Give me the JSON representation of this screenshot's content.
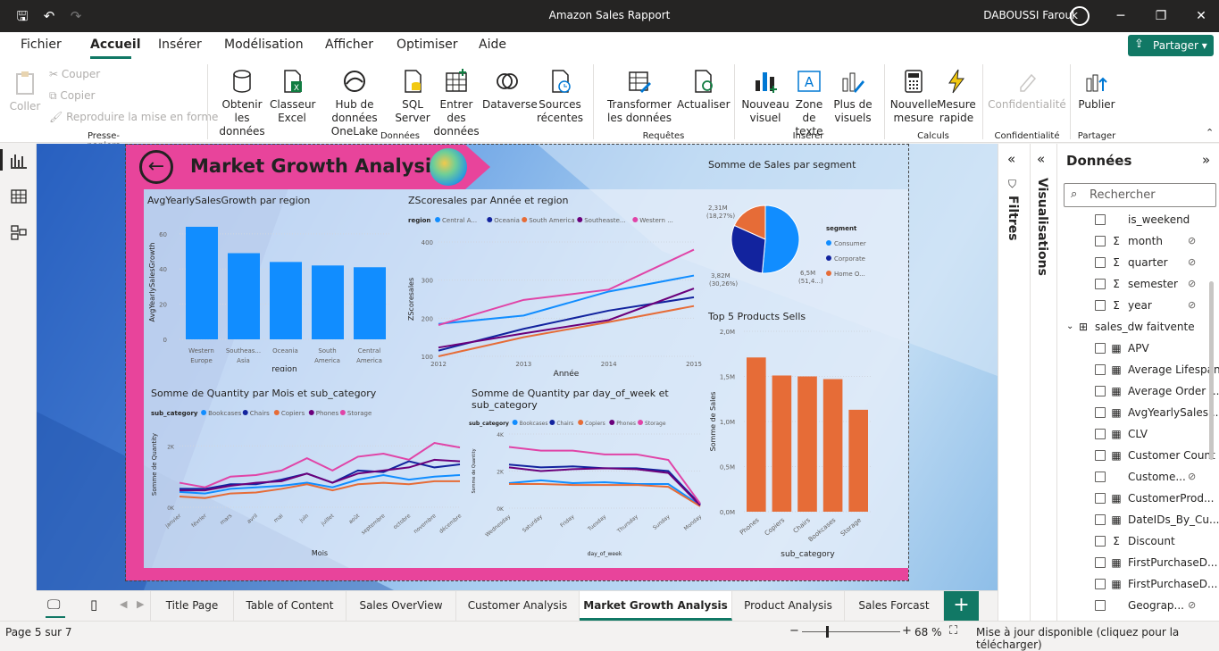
{
  "titlebar": {
    "title": "Amazon Sales Rapport",
    "user": "DABOUSSI Farouk"
  },
  "menu": {
    "items": [
      "Fichier",
      "Accueil",
      "Insérer",
      "Modélisation",
      "Afficher",
      "Optimiser",
      "Aide"
    ],
    "share": "Partager"
  },
  "ribbon": {
    "clipboard": {
      "paste": "Coller",
      "cut": "Couper",
      "copy": "Copier",
      "format": "Reproduire la mise en forme",
      "group": "Presse-papiers"
    },
    "data": {
      "get": "Obtenir les données",
      "excel": "Classeur Excel",
      "onelake": "Hub de données OneLake",
      "sql": "SQL Server",
      "enter": "Entrer des données",
      "dataverse": "Dataverse",
      "recent": "Sources récentes",
      "group": "Données"
    },
    "queries": {
      "transform": "Transformer les données",
      "refresh": "Actualiser",
      "group": "Requêtes"
    },
    "insert": {
      "visual": "Nouveau visuel",
      "textbox": "Zone de texte",
      "more": "Plus de visuels",
      "group": "Insérer"
    },
    "calc": {
      "measure": "Nouvelle mesure",
      "quick": "Mesure rapide",
      "group": "Calculs"
    },
    "sens": {
      "label": "Confidentialité",
      "group": "Confidentialité"
    },
    "share": {
      "publish": "Publier",
      "group": "Partager"
    }
  },
  "report": {
    "title": "Market Growth Analysis",
    "chart1_title": "AvgYearlySalesGrowth par region",
    "chart2_title": "ZScoresales par Année et region",
    "chart3_title": "Somme de Sales par segment",
    "chart4_title": "Top 5 Products Sells",
    "chart5_title": "Somme de Quantity par Mois et sub_category",
    "chart6_title": "Somme de Quantity par day_of_week et sub_category"
  },
  "chart_data": [
    {
      "type": "bar",
      "title": "AvgYearlySalesGrowth par region",
      "xlabel": "region",
      "ylabel": "AvgYearlySalesGrowth",
      "categories": [
        "Western Europe",
        "Southeast Asia",
        "Oceania",
        "South America",
        "Central America"
      ],
      "values": [
        64,
        49,
        44,
        42,
        41
      ],
      "ylim": [
        0,
        65
      ],
      "yticks": [
        0,
        20,
        40,
        60
      ],
      "color": "#118dff"
    },
    {
      "type": "line",
      "title": "ZScoresales par Année et region",
      "xlabel": "Année",
      "ylabel": "ZScoresales",
      "legend_title": "region",
      "x": [
        2012,
        2013,
        2014,
        2015
      ],
      "ylim": [
        100,
        400
      ],
      "yticks": [
        100,
        200,
        300,
        400
      ],
      "series": [
        {
          "name": "Central A...",
          "color": "#118dff",
          "values": [
            185,
            207,
            270,
            312
          ]
        },
        {
          "name": "Oceania",
          "color": "#12239e",
          "values": [
            115,
            172,
            220,
            255
          ]
        },
        {
          "name": "South America",
          "color": "#e66c37",
          "values": [
            100,
            150,
            190,
            232
          ]
        },
        {
          "name": "Southeaste...",
          "color": "#6b007b",
          "values": [
            123,
            160,
            195,
            278
          ]
        },
        {
          "name": "Western ...",
          "color": "#e044a7",
          "values": [
            182,
            248,
            275,
            380
          ]
        }
      ]
    },
    {
      "type": "pie",
      "title": "Somme de Sales par segment",
      "legend_title": "segment",
      "series": [
        {
          "name": "Consumer",
          "color": "#118dff",
          "value": 6.5,
          "label": "6,5M (51,4...)"
        },
        {
          "name": "Corporate",
          "color": "#12239e",
          "value": 3.82,
          "label": "3,82M (30,26%)"
        },
        {
          "name": "Home O...",
          "color": "#e66c37",
          "value": 2.31,
          "label": "2,31M (18,27%)"
        }
      ]
    },
    {
      "type": "bar",
      "title": "Top 5 Products Sells",
      "xlabel": "sub_category",
      "ylabel": "Somme de Sales",
      "categories": [
        "Phones",
        "Copiers",
        "Chairs",
        "Bookcases",
        "Storage"
      ],
      "values": [
        1.71,
        1.51,
        1.5,
        1.47,
        1.13
      ],
      "ylim": [
        0,
        2
      ],
      "yticks": [
        "0,0M",
        "0,5M",
        "1,0M",
        "1,5M",
        "2,0M"
      ],
      "color": "#e66c37"
    },
    {
      "type": "line",
      "title": "Somme de Quantity par Mois et sub_category",
      "xlabel": "Mois",
      "ylabel": "Somme de Quantity",
      "legend_title": "sub_category",
      "x": [
        "janvier",
        "février",
        "mars",
        "avril",
        "mai",
        "juin",
        "juillet",
        "août",
        "septembre",
        "octobre",
        "novembre",
        "décembre"
      ],
      "ylim": [
        0,
        2800
      ],
      "yticks": [
        "0K",
        "2K"
      ],
      "series": [
        {
          "name": "Bookcases",
          "color": "#118dff",
          "values": [
            500,
            450,
            600,
            650,
            700,
            800,
            650,
            900,
            1050,
            900,
            1000,
            1050
          ]
        },
        {
          "name": "Chairs",
          "color": "#12239e",
          "values": [
            600,
            600,
            750,
            750,
            900,
            1100,
            800,
            1200,
            1150,
            1500,
            1300,
            1400
          ]
        },
        {
          "name": "Copiers",
          "color": "#e66c37",
          "values": [
            350,
            300,
            450,
            480,
            600,
            750,
            550,
            750,
            800,
            750,
            850,
            850
          ]
        },
        {
          "name": "Phones",
          "color": "#6b007b",
          "values": [
            550,
            550,
            700,
            800,
            850,
            1100,
            800,
            1100,
            1200,
            1300,
            1550,
            1500
          ]
        },
        {
          "name": "Storage",
          "color": "#e044a7",
          "values": [
            800,
            650,
            1000,
            1050,
            1200,
            1600,
            1200,
            1650,
            1750,
            1550,
            2100,
            1950
          ]
        }
      ]
    },
    {
      "type": "line",
      "title": "Somme de Quantity par day_of_week et sub_category",
      "xlabel": "day_of_week",
      "ylabel": "Somme de Quantity",
      "legend_title": "sub_category",
      "x": [
        "Wednesday",
        "Saturday",
        "Friday",
        "Tuesday",
        "Thursday",
        "Sunday",
        "Monday"
      ],
      "ylim": [
        0,
        4000
      ],
      "yticks": [
        "0K",
        "2K",
        "4K"
      ],
      "series": [
        {
          "name": "Bookcases",
          "color": "#118dff",
          "values": [
            1350,
            1500,
            1350,
            1400,
            1300,
            1300,
            150
          ]
        },
        {
          "name": "Chairs",
          "color": "#12239e",
          "values": [
            2350,
            2200,
            2250,
            2150,
            2150,
            2000,
            200
          ]
        },
        {
          "name": "Copiers",
          "color": "#e66c37",
          "values": [
            1300,
            1300,
            1250,
            1250,
            1250,
            1150,
            100
          ]
        },
        {
          "name": "Phones",
          "color": "#6b007b",
          "values": [
            2200,
            2000,
            2100,
            2150,
            2100,
            1900,
            150
          ]
        },
        {
          "name": "Storage",
          "color": "#e044a7",
          "values": [
            3300,
            3100,
            3100,
            2900,
            2900,
            2600,
            250
          ]
        }
      ]
    }
  ],
  "tabs": [
    "Title Page",
    "Table of Content",
    "Sales OverView",
    "Customer Analysis",
    "Market Growth Analysis",
    "Product Analysis",
    "Sales Forcast"
  ],
  "status": {
    "page": "Page 5 sur 7",
    "zoom": "68 %",
    "update": "Mise à jour disponible (cliquez pour la télécharger)"
  },
  "panes": {
    "filters": "Filtres",
    "visualisations": "Visualisations",
    "data": "Données",
    "search_placeholder": "Rechercher"
  },
  "fields": [
    {
      "label": "is_weekend",
      "icon": "",
      "hidden": false,
      "cb": true
    },
    {
      "label": "month",
      "icon": "Σ",
      "hidden": true,
      "cb": true
    },
    {
      "label": "quarter",
      "icon": "Σ",
      "hidden": true,
      "cb": true
    },
    {
      "label": "semester",
      "icon": "Σ",
      "hidden": true,
      "cb": true
    },
    {
      "label": "year",
      "icon": "Σ",
      "hidden": true,
      "cb": true
    },
    {
      "label": "sales_dw faitvente",
      "icon": "table",
      "hidden": false,
      "cb": false
    },
    {
      "label": "APV",
      "icon": "calc",
      "hidden": false,
      "cb": true
    },
    {
      "label": "Average Lifespan",
      "icon": "calc",
      "hidden": false,
      "cb": true
    },
    {
      "label": "Average Order ...",
      "icon": "calc",
      "hidden": false,
      "cb": true
    },
    {
      "label": "AvgYearlySales...",
      "icon": "calc",
      "hidden": false,
      "cb": true
    },
    {
      "label": "CLV",
      "icon": "calc",
      "hidden": false,
      "cb": true
    },
    {
      "label": "Customer Count",
      "icon": "calc",
      "hidden": false,
      "cb": true
    },
    {
      "label": "Custome...",
      "icon": "",
      "hidden": true,
      "cb": true
    },
    {
      "label": "CustomerProd...",
      "icon": "calc",
      "hidden": false,
      "cb": true
    },
    {
      "label": "DateIDs_By_Cu...",
      "icon": "calc",
      "hidden": false,
      "cb": true
    },
    {
      "label": "Discount",
      "icon": "Σ",
      "hidden": false,
      "cb": true
    },
    {
      "label": "FirstPurchaseD...",
      "icon": "calc",
      "hidden": false,
      "cb": true
    },
    {
      "label": "FirstPurchaseD...",
      "icon": "calc",
      "hidden": false,
      "cb": true
    },
    {
      "label": "Geograp...",
      "icon": "",
      "hidden": true,
      "cb": true
    }
  ]
}
